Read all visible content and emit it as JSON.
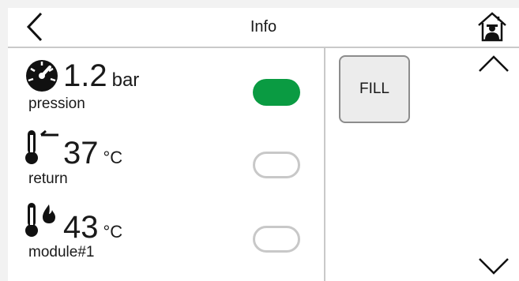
{
  "header": {
    "title": "Info",
    "back_icon": "chevron-left-icon",
    "home_icon": "home-icon"
  },
  "rows": [
    {
      "icon": "gauge-icon",
      "value": "1.2",
      "unit": "bar",
      "label": "pression",
      "toggle_on": true
    },
    {
      "icon": "thermometer-return-icon",
      "value": "37",
      "unit": "°C",
      "label": "return",
      "toggle_on": false
    },
    {
      "icon": "thermometer-flame-icon",
      "value": "43",
      "unit": "°C",
      "label": "module#1",
      "toggle_on": false
    }
  ],
  "actions": {
    "fill_label": "FILL"
  },
  "scroll": {
    "up_icon": "chevron-up-icon",
    "down_icon": "chevron-down-icon"
  },
  "colors": {
    "toggle_on": "#0a9b42",
    "toggle_off_border": "#c8c8c8",
    "divider": "#c9c9c9"
  }
}
